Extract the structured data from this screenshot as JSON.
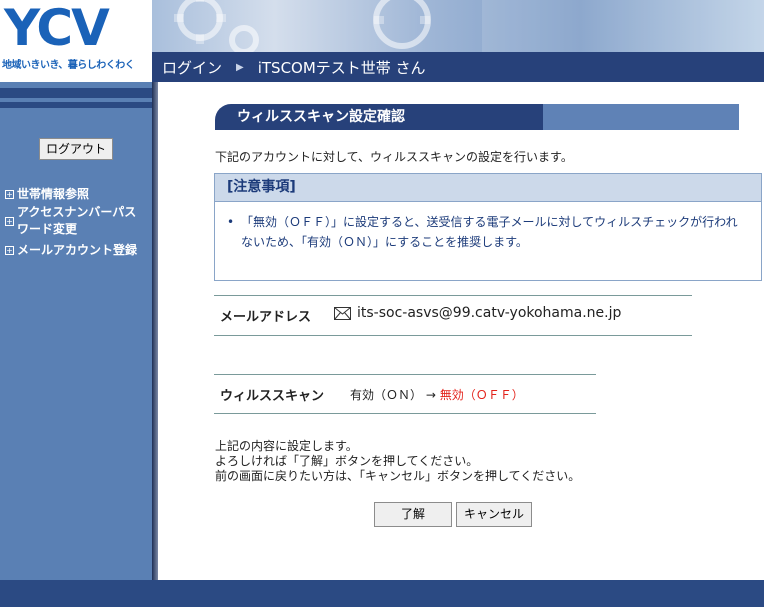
{
  "header": {
    "logo": "YCV",
    "tagline": "地域いきいき、暮らしわくわく",
    "nav": {
      "login": "ログイン",
      "separator": "▶",
      "household": "iTSCOMテスト世帯 さん"
    }
  },
  "sidebar": {
    "logout_label": "ログアウト",
    "menu": [
      {
        "label": "世帯情報参照"
      },
      {
        "label": "アクセスナンバーパスワード変更"
      },
      {
        "label": "メールアカウント登録"
      }
    ]
  },
  "main": {
    "section_title": "ウィルススキャン設定確認",
    "intro": "下記のアカウントに対して、ウィルススキャンの設定を行います。",
    "notice": {
      "heading": "[注意事項]",
      "bullet": "•",
      "body": "「無効（ＯＦＦ）」に設定すると、送受信する電子メールに対してウィルスチェックが行われないため、「有効（ＯＮ）」にすることを推奨します。"
    },
    "mail": {
      "label": "メールアドレス",
      "icon": "envelope-icon",
      "address": "its-soc-asvs@99.catv-yokohama.ne.jp"
    },
    "scan": {
      "label": "ウィルススキャン",
      "current": "有効（ＯＮ）",
      "arrow": "→",
      "new_value": "無効（ＯＦＦ）"
    },
    "confirm": {
      "line1": "上記の内容に設定します。",
      "line2": "よろしければ「了解」ボタンを押してください。",
      "line3": "前の画面に戻りたい方は、「キャンセル」ボタンを押してください。"
    },
    "buttons": {
      "ok": "了解",
      "cancel": "キャンセル"
    }
  },
  "colors": {
    "navy": "#27417a",
    "sidebar": "#5a80b4",
    "notice_text": "#1c3b7a",
    "warning": "#e3231b"
  }
}
